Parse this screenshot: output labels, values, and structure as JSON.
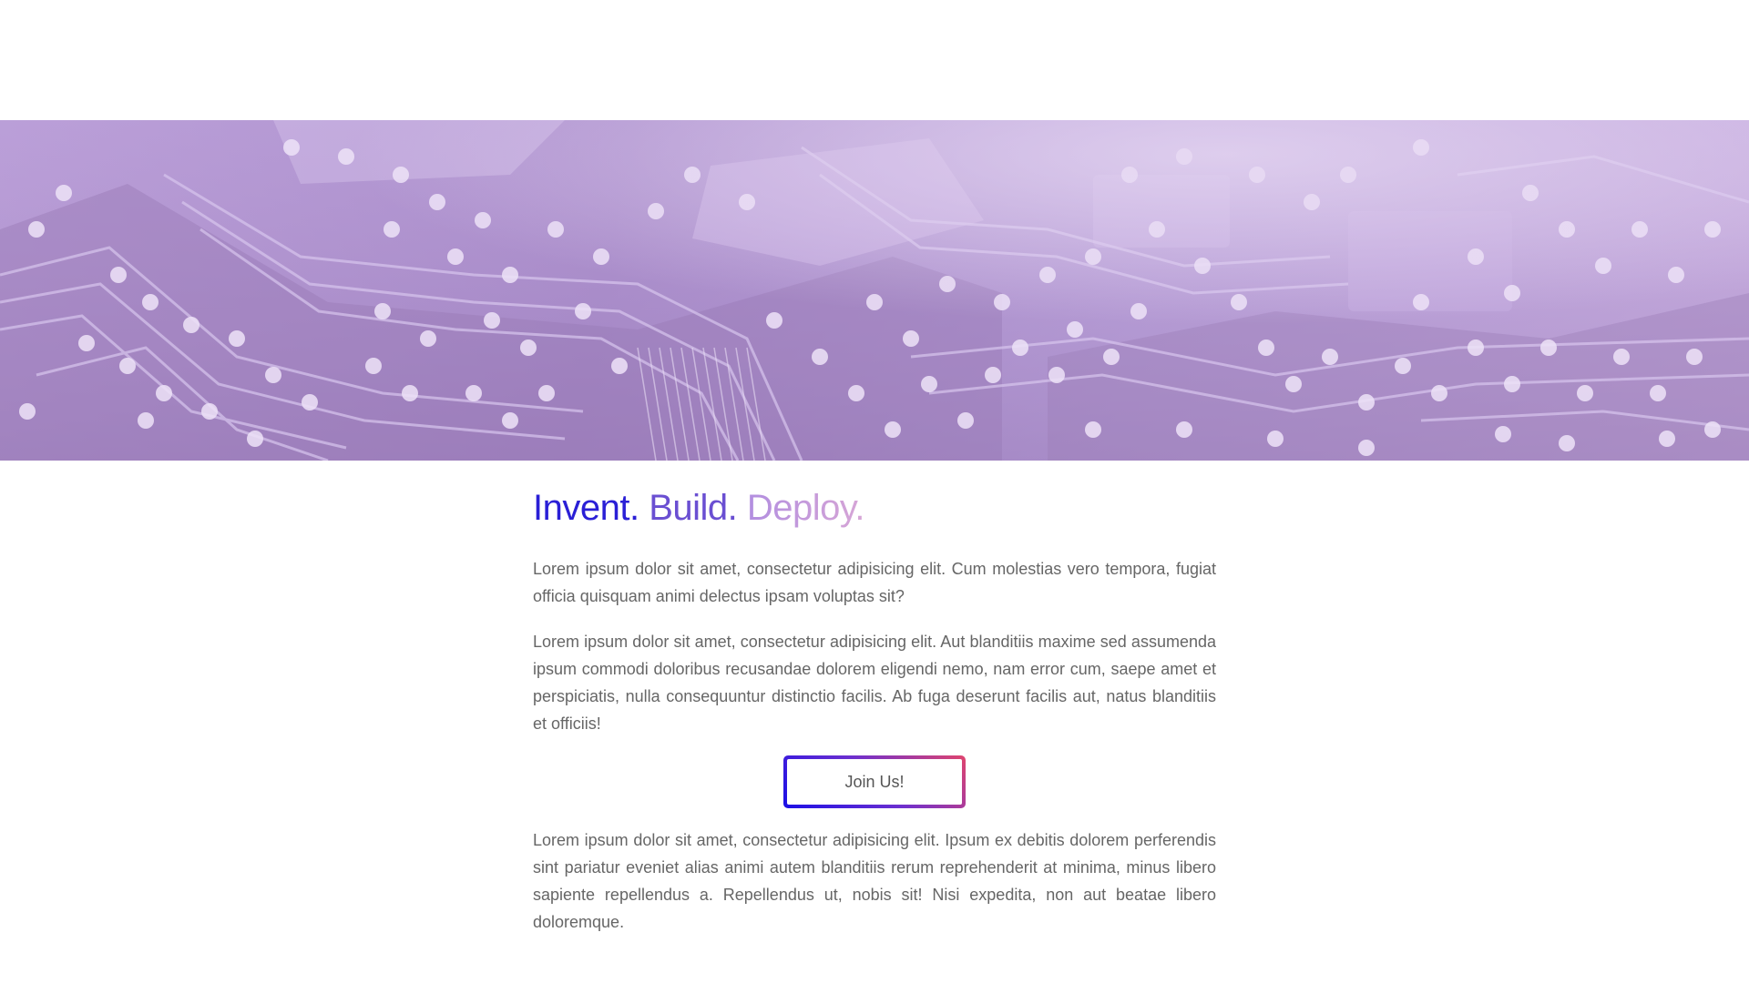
{
  "hero": {
    "image": "circuit-board-photo",
    "tint_color": "#b79bd6"
  },
  "headline": {
    "word1": "Invent.",
    "word2": "Build.",
    "word3": "Deploy.",
    "colors": [
      "#2a1fd6",
      "#6a4fd2",
      "#c89bde"
    ]
  },
  "paragraphs": {
    "p1": "Lorem ipsum dolor sit amet, consectetur adipisicing elit. Cum molestias vero tempora, fugiat officia quisquam animi delectus ipsam voluptas sit?",
    "p2": "Lorem ipsum dolor sit amet, consectetur adipisicing elit. Aut blanditiis maxime sed assumenda ipsum commodi doloribus recusandae dolorem eligendi nemo, nam error cum, saepe amet et perspiciatis, nulla consequuntur distinctio facilis. Ab fuga deserunt facilis aut, natus blanditiis et officiis!",
    "p3": "Lorem ipsum dolor sit amet, consectetur adipisicing elit. Ipsum ex debitis dolorem perferendis sint pariatur eveniet alias animi autem blanditiis rerum reprehenderit at minima, minus libero sapiente repellendus a. Repellendus ut, nobis sit! Nisi expedita, non aut beatae libero doloremque."
  },
  "cta": {
    "label": "Join Us!",
    "border_gradient": [
      "#1b0fe6",
      "#6b2fd0",
      "#e0456e"
    ]
  }
}
